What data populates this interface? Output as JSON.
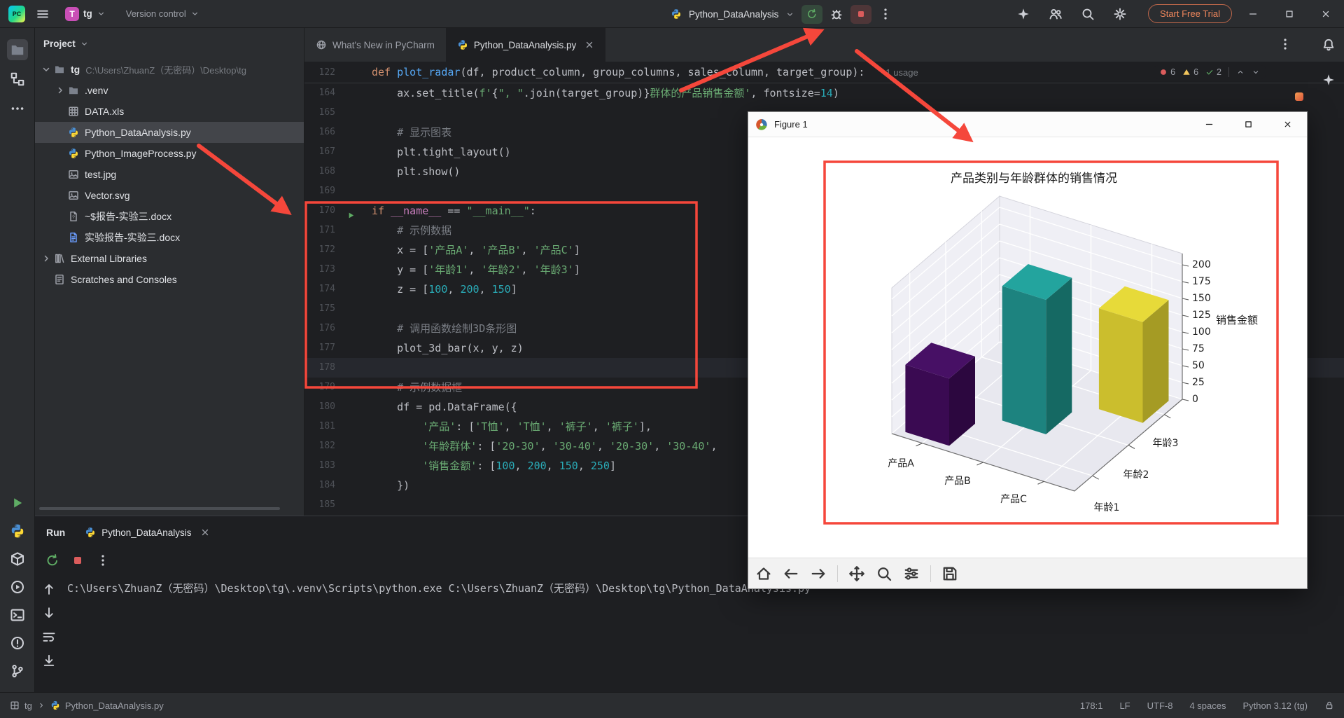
{
  "titlebar": {
    "project_avatar": "T",
    "project_name": "tg",
    "vcs": "Version control",
    "run_config": "Python_DataAnalysis",
    "trial": "Start Free Trial"
  },
  "project_panel": {
    "header": "Project",
    "tree": [
      {
        "label": "tg",
        "suffix": "C:\\Users\\ZhuanZ（无密码）\\Desktop\\tg",
        "icon": "folder",
        "chevron": "down",
        "indent": 0,
        "bold": true
      },
      {
        "label": ".venv",
        "icon": "folder",
        "chevron": "right",
        "indent": 1
      },
      {
        "label": "DATA.xls",
        "icon": "xls",
        "indent": 1
      },
      {
        "label": "Python_DataAnalysis.py",
        "icon": "python",
        "indent": 1,
        "selected": true
      },
      {
        "label": "Python_ImageProcess.py",
        "icon": "python",
        "indent": 1
      },
      {
        "label": "test.jpg",
        "icon": "image",
        "indent": 1
      },
      {
        "label": "Vector.svg",
        "icon": "image",
        "indent": 1
      },
      {
        "label": "~$报告-实验三.docx",
        "icon": "docq",
        "indent": 1
      },
      {
        "label": "实验报告-实验三.docx",
        "icon": "doc",
        "indent": 1
      },
      {
        "label": "External Libraries",
        "icon": "lib",
        "chevron": "right",
        "indent": 0
      },
      {
        "label": "Scratches and Consoles",
        "icon": "scratch",
        "indent": 0
      }
    ]
  },
  "editor": {
    "tabs": [
      {
        "label": "What's New in PyCharm"
      },
      {
        "label": "Python_DataAnalysis.py"
      }
    ],
    "inspections": {
      "errors": "6",
      "warnings": "6",
      "passed": "2"
    },
    "sticky": {
      "n": "122",
      "usage": "1 usage",
      "t": [
        [
          "kw",
          "def"
        ],
        [
          "d",
          " "
        ],
        [
          "fn",
          "plot_radar"
        ],
        [
          "d",
          "(df, product_column, group_columns, sales_column, target_group):"
        ]
      ]
    },
    "lines": [
      {
        "n": "164",
        "t": [
          [
            "d",
            "    ax.set_title("
          ],
          [
            "str",
            "f'"
          ],
          [
            "d",
            "{"
          ],
          [
            "str",
            "\", \""
          ],
          [
            "d",
            ".join(target_group)}"
          ],
          [
            "str",
            "群体的产品销售金额'"
          ],
          [
            "d",
            ", fontsize="
          ],
          [
            "num",
            "14"
          ],
          [
            "d",
            ")"
          ]
        ]
      },
      {
        "n": "165",
        "t": []
      },
      {
        "n": "166",
        "t": [
          [
            "com",
            "    # 显示图表"
          ]
        ]
      },
      {
        "n": "167",
        "t": [
          [
            "d",
            "    plt.tight_layout()"
          ]
        ]
      },
      {
        "n": "168",
        "t": [
          [
            "d",
            "    plt.show()"
          ]
        ]
      },
      {
        "n": "169",
        "t": []
      },
      {
        "n": "170",
        "run": true,
        "t": [
          [
            "kw",
            "if"
          ],
          [
            "d",
            " "
          ],
          [
            "sp",
            "__name__"
          ],
          [
            "d",
            " == "
          ],
          [
            "str",
            "\"__main__\""
          ],
          [
            "d",
            ":"
          ]
        ]
      },
      {
        "n": "171",
        "t": [
          [
            "com",
            "    # 示例数据"
          ]
        ]
      },
      {
        "n": "172",
        "t": [
          [
            "d",
            "    x = ["
          ],
          [
            "str",
            "'产品A'"
          ],
          [
            "d",
            ", "
          ],
          [
            "str",
            "'产品B'"
          ],
          [
            "d",
            ", "
          ],
          [
            "str",
            "'产品C'"
          ],
          [
            "d",
            "]"
          ]
        ]
      },
      {
        "n": "173",
        "t": [
          [
            "d",
            "    y = ["
          ],
          [
            "str",
            "'年龄1'"
          ],
          [
            "d",
            ", "
          ],
          [
            "str",
            "'年龄2'"
          ],
          [
            "d",
            ", "
          ],
          [
            "str",
            "'年龄3'"
          ],
          [
            "d",
            "]"
          ]
        ]
      },
      {
        "n": "174",
        "t": [
          [
            "d",
            "    z = ["
          ],
          [
            "num",
            "100"
          ],
          [
            "d",
            ", "
          ],
          [
            "num",
            "200"
          ],
          [
            "d",
            ", "
          ],
          [
            "num",
            "150"
          ],
          [
            "d",
            "]"
          ]
        ]
      },
      {
        "n": "175",
        "t": []
      },
      {
        "n": "176",
        "t": [
          [
            "com",
            "    # 调用函数绘制3D条形图"
          ]
        ]
      },
      {
        "n": "177",
        "t": [
          [
            "d",
            "    plot_3d_bar(x, y, z)"
          ]
        ]
      },
      {
        "n": "178",
        "active": true,
        "t": []
      },
      {
        "n": "179",
        "t": [
          [
            "com",
            "    # 示例数据框"
          ]
        ]
      },
      {
        "n": "180",
        "t": [
          [
            "d",
            "    df = pd.DataFrame({"
          ]
        ]
      },
      {
        "n": "181",
        "t": [
          [
            "d",
            "        "
          ],
          [
            "str",
            "'产品'"
          ],
          [
            "d",
            ": ["
          ],
          [
            "str",
            "'T恤'"
          ],
          [
            "d",
            ", "
          ],
          [
            "str",
            "'T恤'"
          ],
          [
            "d",
            ", "
          ],
          [
            "str",
            "'裤子'"
          ],
          [
            "d",
            ", "
          ],
          [
            "str",
            "'裤子'"
          ],
          [
            "d",
            "],"
          ]
        ]
      },
      {
        "n": "182",
        "t": [
          [
            "d",
            "        "
          ],
          [
            "str",
            "'年龄群体'"
          ],
          [
            "d",
            ": ["
          ],
          [
            "str",
            "'20-30'"
          ],
          [
            "d",
            ", "
          ],
          [
            "str",
            "'30-40'"
          ],
          [
            "d",
            ", "
          ],
          [
            "str",
            "'20-30'"
          ],
          [
            "d",
            ", "
          ],
          [
            "str",
            "'30-40'"
          ],
          [
            "d",
            ","
          ]
        ]
      },
      {
        "n": "183",
        "t": [
          [
            "d",
            "        "
          ],
          [
            "str",
            "'销售金额'"
          ],
          [
            "d",
            ": ["
          ],
          [
            "num",
            "100"
          ],
          [
            "d",
            ", "
          ],
          [
            "num",
            "200"
          ],
          [
            "d",
            ", "
          ],
          [
            "num",
            "150"
          ],
          [
            "d",
            ", "
          ],
          [
            "num",
            "250"
          ],
          [
            "d",
            "]"
          ]
        ]
      },
      {
        "n": "184",
        "t": [
          [
            "d",
            "    })"
          ]
        ]
      },
      {
        "n": "185",
        "t": []
      }
    ]
  },
  "run_panel": {
    "title": "Run",
    "tab": "Python_DataAnalysis",
    "console": "C:\\Users\\ZhuanZ（无密码）\\Desktop\\tg\\.venv\\Scripts\\python.exe C:\\Users\\ZhuanZ（无密码）\\Desktop\\tg\\Python_DataAnalysis.py"
  },
  "status_bar": {
    "project": "tg",
    "file": "Python_DataAnalysis.py",
    "items": [
      "178:1",
      "LF",
      "UTF-8",
      "4 spaces",
      "Python 3.12 (tg)"
    ]
  },
  "figure_window": {
    "title": "Figure 1"
  },
  "chart_data": {
    "type": "bar",
    "subtype": "bar3d",
    "title": "产品类别与年龄群体的销售情况",
    "x_categories": [
      "产品A",
      "产品B",
      "产品C"
    ],
    "y_categories": [
      "年龄1",
      "年龄2",
      "年龄3"
    ],
    "values": [
      100,
      200,
      150
    ],
    "zlabel": "销售金额",
    "zlim": [
      0,
      200
    ],
    "z_ticks_display": [
      "200",
      "175",
      "150",
      "125",
      "100",
      "75",
      "50",
      "25",
      "0"
    ],
    "bar_colors": [
      "#440f63",
      "#1f918d",
      "#e3d63c"
    ],
    "grid": true,
    "legend": false
  }
}
